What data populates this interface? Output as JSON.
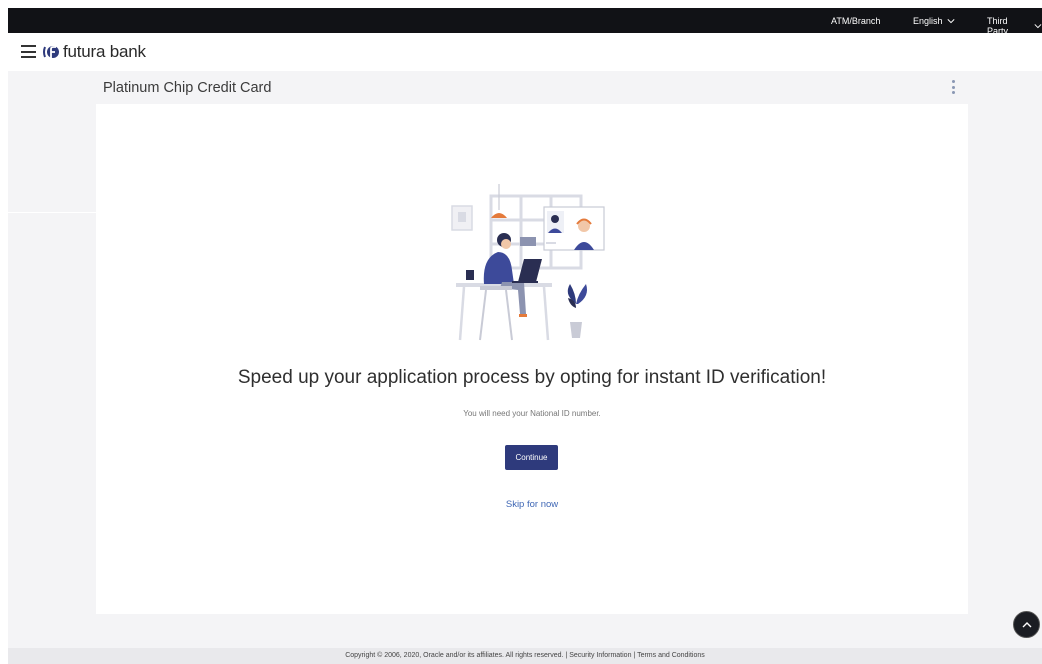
{
  "topbar": {
    "atm_branch": "ATM/Branch",
    "language": "English",
    "third_party": "Third Party"
  },
  "header": {
    "brand_name": "futura bank"
  },
  "page": {
    "title": "Platinum Chip Credit Card"
  },
  "content": {
    "headline": "Speed up your application process by opting for instant ID verification!",
    "subtext": "You will need your National ID number.",
    "continue_label": "Continue",
    "skip_label": "Skip for now"
  },
  "footer": {
    "copyright": "Copyright © 2006, 2020, Oracle and/or its affiliates. All rights reserved.",
    "separator": "|",
    "security_label": "Security Information",
    "terms_label": "Terms and Conditions"
  },
  "colors": {
    "topbar_bg": "#111216",
    "primary_button": "#2e3a7c",
    "link": "#3f67b5",
    "page_bg": "#f4f4f6"
  },
  "icons": {
    "menu": "hamburger-icon",
    "brand": "futura-logo-icon",
    "dropdown": "chevron-down-icon",
    "more": "kebab-icon",
    "scroll_top": "chevron-up-icon"
  }
}
